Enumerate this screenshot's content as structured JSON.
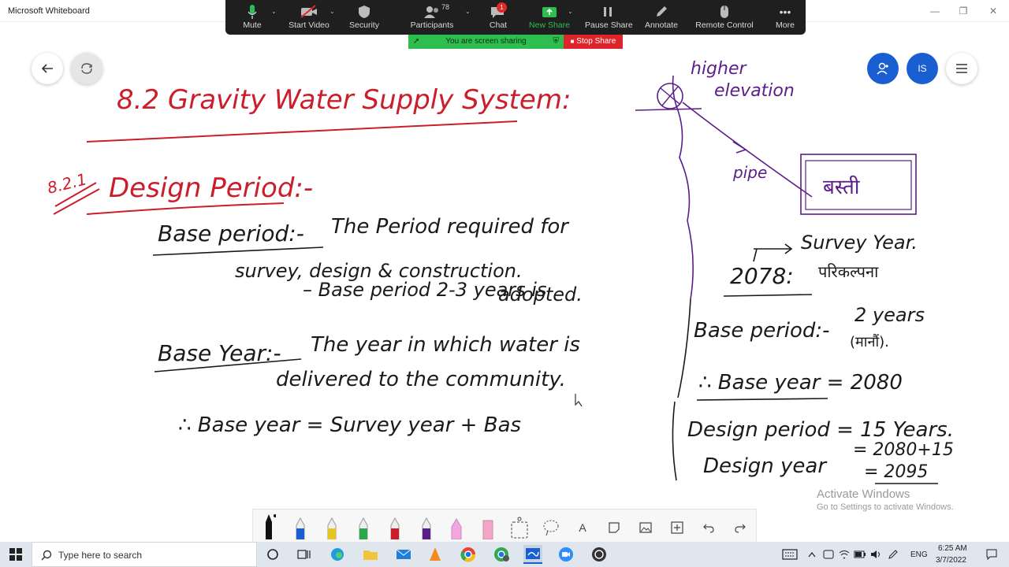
{
  "app": {
    "title": "Microsoft Whiteboard"
  },
  "zoom": {
    "mute": "Mute",
    "start_video": "Start Video",
    "security": "Security",
    "participants": "Participants",
    "participants_count": "78",
    "chat": "Chat",
    "chat_badge": "1",
    "new_share": "New Share",
    "pause_share": "Pause Share",
    "annotate": "Annotate",
    "remote_control": "Remote Control",
    "more": "More",
    "sharing_text": "You are screen sharing",
    "stop_share": "Stop Share"
  },
  "whiteboard": {
    "user_initials": "IS",
    "title": "8.2 Gravity Water Supply System:",
    "section_number": "8.2.1",
    "section_title": "Design Period:-",
    "base_period_term": "Base period:-",
    "base_period_def_1": "The Period required for",
    "base_period_def_2": "survey, design & construction.",
    "base_period_def_3": "– Base period 2-3 years is",
    "base_period_def_4": "adopted.",
    "base_year_term": "Base Year:-",
    "base_year_def_1": "The year in which water is",
    "base_year_def_2": "delivered to the community.",
    "formula": "∴ Base year = Survey year + Bas",
    "diagram_label_elevation_1": "higher",
    "diagram_label_elevation_2": "elevation",
    "diagram_label_pipe": "pipe",
    "diagram_box_label": "बस्ती",
    "survey_year_label": "Survey Year.",
    "survey_year_value": "2078:",
    "survey_year_note": "परिकल्पना",
    "ex_base_period_term": "Base period:-",
    "ex_base_period_value": "2 years",
    "ex_base_period_note": "(मानौं).",
    "ex_base_year": "∴ Base year = 2080",
    "ex_design_period": "Design period = 15 Years.",
    "ex_design_year_term": "Design year",
    "ex_design_year_calc": "= 2080+15",
    "ex_design_year_result": "= 2095"
  },
  "watermark": {
    "line1": "Activate Windows",
    "line2": "Go to Settings to activate Windows."
  },
  "taskbar": {
    "search_placeholder": "Type here to search",
    "language": "ENG",
    "time": "6:25 AM",
    "date": "3/7/2022"
  },
  "colors": {
    "ink_red": "#cc1d2b",
    "ink_black": "#1a1a1a",
    "ink_purple": "#5b1d8a",
    "zoom_green": "#2dbe4f",
    "zoom_red": "#e0242c",
    "avatar_blue": "#1a5fd1"
  }
}
